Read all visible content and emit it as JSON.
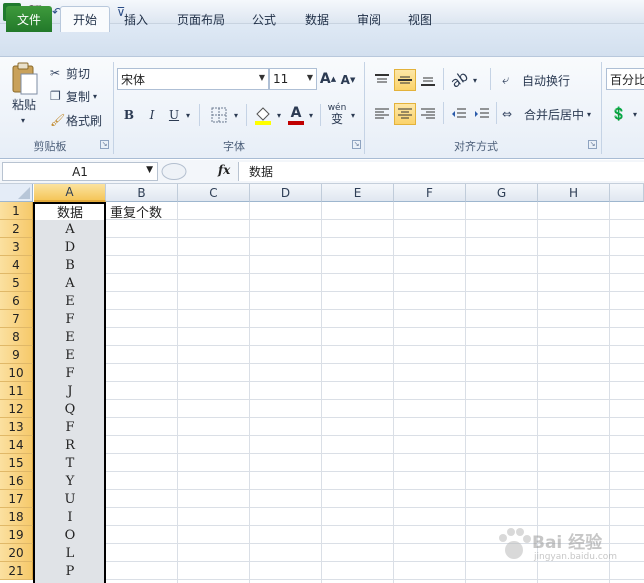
{
  "app": {
    "name": "Microsoft Excel",
    "brand_color": "#1f7a2f"
  },
  "quick_access": [
    {
      "name": "excel-logo-icon",
      "glyph": "X"
    },
    {
      "name": "save-icon",
      "glyph": "💾"
    },
    {
      "name": "undo-icon",
      "glyph": "↶"
    },
    {
      "name": "undo-dropdown-icon",
      "glyph": "▾"
    },
    {
      "name": "redo-icon",
      "glyph": "↷"
    },
    {
      "name": "redo-dropdown-icon",
      "glyph": "▾"
    },
    {
      "name": "customize-qat-icon",
      "glyph": "⊽"
    }
  ],
  "tabs": [
    {
      "id": "file",
      "label": "文件"
    },
    {
      "id": "home",
      "label": "开始"
    },
    {
      "id": "insert",
      "label": "插入"
    },
    {
      "id": "page_layout",
      "label": "页面布局"
    },
    {
      "id": "formulas",
      "label": "公式"
    },
    {
      "id": "data",
      "label": "数据"
    },
    {
      "id": "review",
      "label": "审阅"
    },
    {
      "id": "view",
      "label": "视图"
    }
  ],
  "ribbon": {
    "clipboard": {
      "group_label": "剪贴板",
      "paste_label": "粘贴",
      "cut_label": "剪切",
      "copy_label": "复制",
      "format_painter_label": "格式刷"
    },
    "font": {
      "group_label": "字体",
      "font_name": "宋体",
      "font_size": "11",
      "bold": "B",
      "italic": "I",
      "underline": "U",
      "grow_font": "A",
      "shrink_font": "A",
      "font_color": "A",
      "phonetic": "wén",
      "phonetic_sub": "变",
      "font_color_hex": "#c00000",
      "fill_color_hex": "#ffff00"
    },
    "alignment": {
      "group_label": "对齐方式",
      "wrap_text_label": "自动换行",
      "merge_center_label": "合并后居中"
    },
    "number": {
      "format_value": "百分比"
    }
  },
  "formula_bar": {
    "name_box": "A1",
    "fx_label": "fx",
    "content": "数据"
  },
  "grid": {
    "columns": [
      "A",
      "B",
      "C",
      "D",
      "E",
      "F",
      "G",
      "H"
    ],
    "rows": [
      "1",
      "2",
      "3",
      "4",
      "5",
      "6",
      "7",
      "8",
      "9",
      "10",
      "11",
      "12",
      "13",
      "14",
      "15",
      "16",
      "17",
      "18",
      "19",
      "20",
      "21"
    ],
    "header_A1": "数据",
    "header_B1": "重复个数",
    "colA_values": [
      "A",
      "D",
      "B",
      "A",
      "E",
      "F",
      "E",
      "E",
      "F",
      "J",
      "Q",
      "F",
      "R",
      "T",
      "Y",
      "U",
      "I",
      "O",
      "L",
      "P"
    ]
  },
  "watermark": {
    "text": "Bai 经验",
    "sub": "jingyan.baidu.com"
  }
}
